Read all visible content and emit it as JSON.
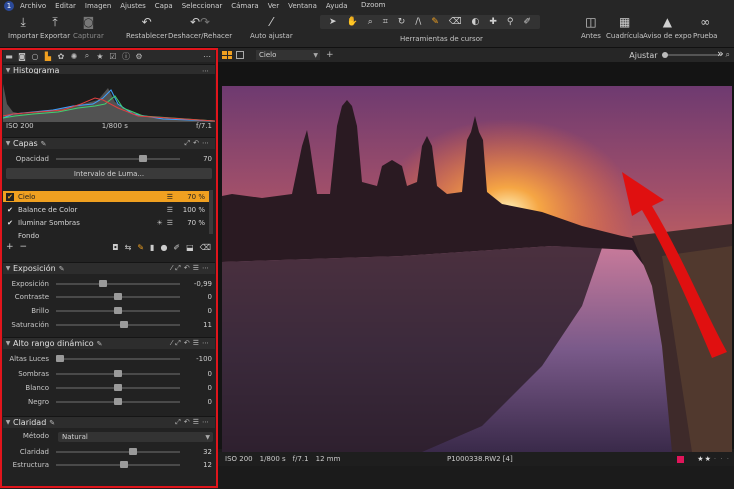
{
  "menu": {
    "app_title": "Dzoom",
    "items": [
      "Archivo",
      "Editar",
      "Imagen",
      "Ajustes",
      "Capa",
      "Seleccionar",
      "Cámara",
      "Ver",
      "Ventana",
      "Ayuda"
    ]
  },
  "toolbar": {
    "import": "Importar",
    "export": "Exportar",
    "capture": "Capturar",
    "reset": "Restablecer",
    "undo_redo": "Deshacer/Rehacer",
    "auto_adjust": "Auto ajustar",
    "cursor_tools": "Herramientas de cursor",
    "before": "Antes",
    "grid": "Cuadrícula",
    "exposure_warning": "Aviso de expo",
    "proof": "Prueba"
  },
  "histogram": {
    "title": "Histograma",
    "iso": "ISO 200",
    "shutter": "1/800 s",
    "aperture": "f/7.1"
  },
  "layers": {
    "title": "Capas",
    "opacity_label": "Opacidad",
    "opacity_value": "70",
    "opacity_fraction": 0.7,
    "luma_button": "Intervalo de Luma...",
    "items": [
      {
        "name": "Cielo",
        "opacity": "70 %",
        "selected": true,
        "checked": true
      },
      {
        "name": "Balance de Color",
        "opacity": "100 %",
        "selected": false,
        "checked": true
      },
      {
        "name": "Iluminar Sombras",
        "opacity": "70 %",
        "selected": false,
        "checked": true
      },
      {
        "name": "Fondo",
        "opacity": "",
        "selected": false,
        "checked": false
      }
    ]
  },
  "exposure": {
    "title": "Exposición",
    "sliders": [
      {
        "label": "Exposición",
        "value": "-0,99",
        "fraction": 0.38
      },
      {
        "label": "Contraste",
        "value": "0",
        "fraction": 0.5
      },
      {
        "label": "Brillo",
        "value": "0",
        "fraction": 0.5
      },
      {
        "label": "Saturación",
        "value": "11",
        "fraction": 0.55
      }
    ]
  },
  "hdr": {
    "title": "Alto rango dinámico",
    "sliders": [
      {
        "label": "Altas Luces",
        "value": "-100",
        "fraction": 0.0
      },
      {
        "label": "Sombras",
        "value": "0",
        "fraction": 0.5
      },
      {
        "label": "Blanco",
        "value": "0",
        "fraction": 0.5
      },
      {
        "label": "Negro",
        "value": "0",
        "fraction": 0.5
      }
    ]
  },
  "clarity": {
    "title": "Claridad",
    "method_label": "Método",
    "method_value": "Natural",
    "sliders": [
      {
        "label": "Claridad",
        "value": "32",
        "fraction": 0.62
      },
      {
        "label": "Estructura",
        "value": "12",
        "fraction": 0.55
      }
    ]
  },
  "viewer": {
    "layer_select": "Cielo",
    "fit_label": "Ajustar",
    "iso": "ISO 200",
    "shutter": "1/800 s",
    "aperture": "f/7.1",
    "focal": "12 mm",
    "filename": "P1000338.RW2 [4]",
    "rating": "★★",
    "rating_stars": 2,
    "color_tag": "#e0155a"
  },
  "colors": {
    "accent": "#f0a020",
    "highlight_frame": "#e0151c",
    "annotation_arrow": "#e01010"
  }
}
